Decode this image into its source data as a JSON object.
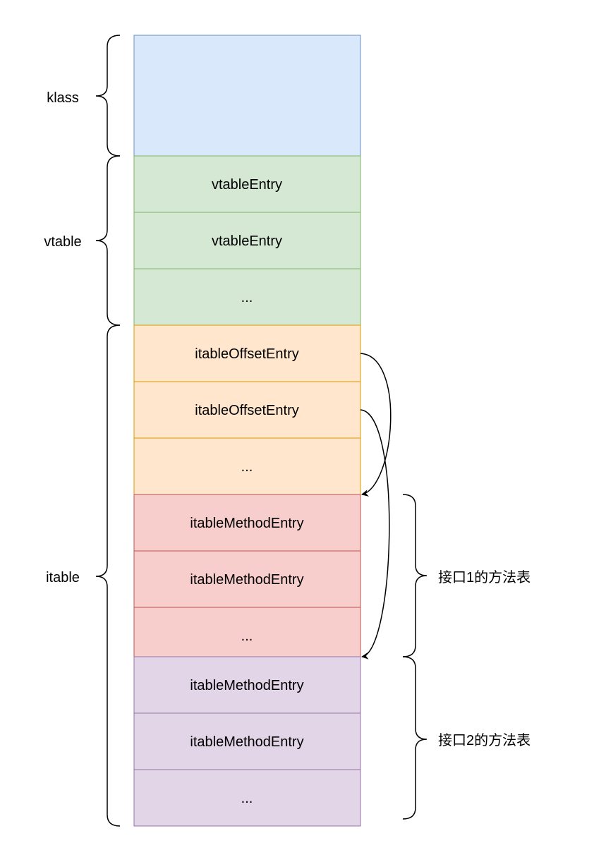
{
  "colors": {
    "klass_fill": "#dae8fc",
    "klass_stroke": "#6c8ebf",
    "vtable_fill": "#d5e8d4",
    "vtable_stroke": "#82b366",
    "offset_fill": "#ffe6cc",
    "offset_stroke": "#d79b00",
    "method1_fill": "#f8cecc",
    "method1_stroke": "#b85450",
    "method2_fill": "#e1d5e7",
    "method2_stroke": "#9673a6",
    "line": "#000000"
  },
  "cells": [
    {
      "group": "klass",
      "text": ""
    },
    {
      "group": "vtable",
      "text": "vtableEntry"
    },
    {
      "group": "vtable",
      "text": "vtableEntry"
    },
    {
      "group": "vtable",
      "text": "..."
    },
    {
      "group": "offset",
      "text": "itableOffsetEntry"
    },
    {
      "group": "offset",
      "text": "itableOffsetEntry"
    },
    {
      "group": "offset",
      "text": "..."
    },
    {
      "group": "method1",
      "text": "itableMethodEntry"
    },
    {
      "group": "method1",
      "text": "itableMethodEntry"
    },
    {
      "group": "method1",
      "text": "..."
    },
    {
      "group": "method2",
      "text": "itableMethodEntry"
    },
    {
      "group": "method2",
      "text": "itableMethodEntry"
    },
    {
      "group": "method2",
      "text": "..."
    }
  ],
  "left_labels": {
    "klass": "klass",
    "vtable": "vtable",
    "itable": "itable"
  },
  "right_labels": {
    "iface1": "接口1的方法表",
    "iface2": "接口2的方法表"
  }
}
